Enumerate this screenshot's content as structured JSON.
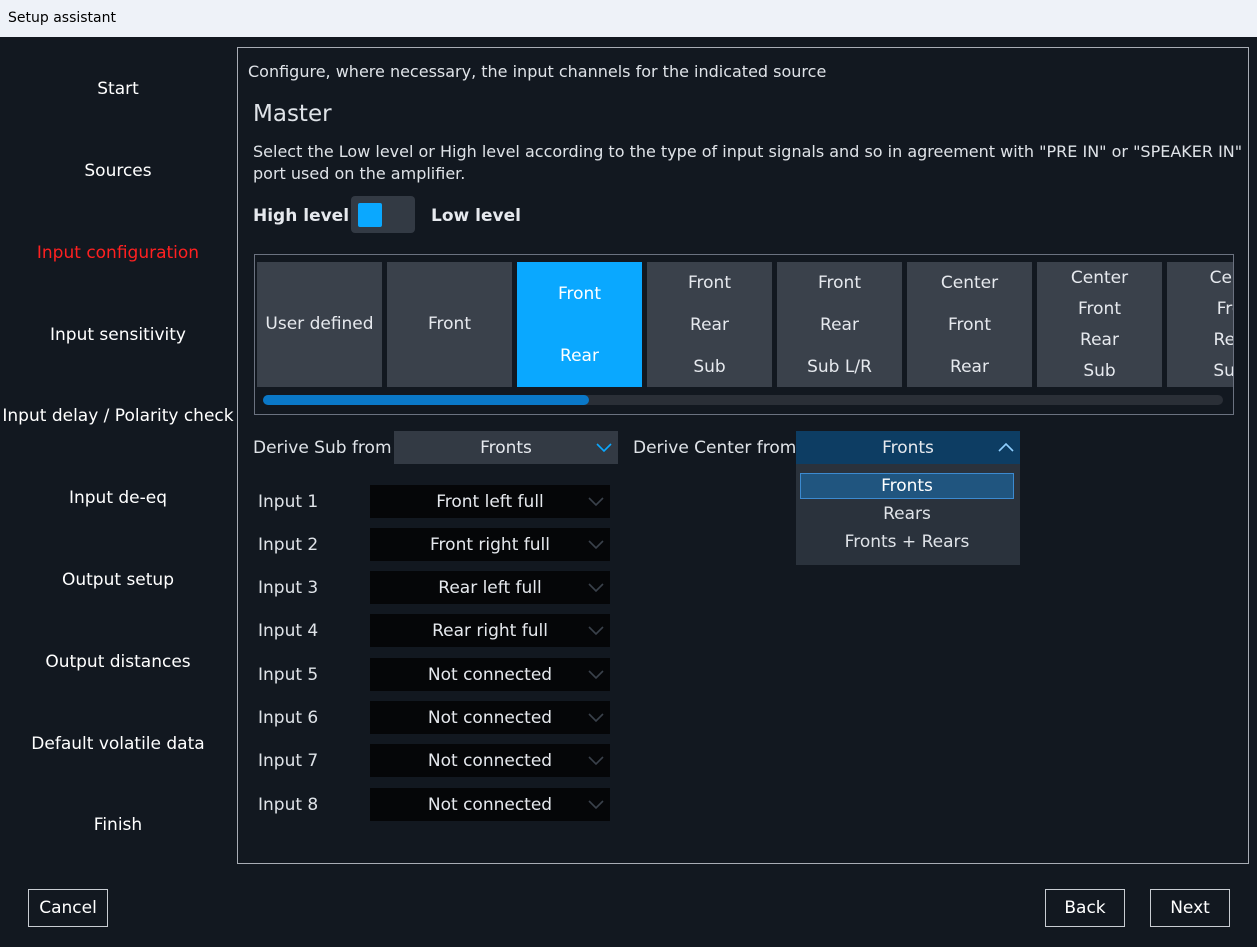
{
  "window": {
    "title": "Setup assistant"
  },
  "sidebar": {
    "items": [
      {
        "label": "Start"
      },
      {
        "label": "Sources"
      },
      {
        "label": "Input configuration",
        "active": true
      },
      {
        "label": "Input sensitivity"
      },
      {
        "label": "Input delay / Polarity check"
      },
      {
        "label": "Input de-eq"
      },
      {
        "label": "Output setup"
      },
      {
        "label": "Output distances"
      },
      {
        "label": "Default volatile data"
      },
      {
        "label": "Finish"
      }
    ],
    "active_color": "#ff2020"
  },
  "main": {
    "intro": "Configure, where necessary, the input channels for the indicated source",
    "section_title": "Master",
    "description": "Select the Low level or High level according to the type of input signals and so in agreement with \"PRE IN\" or \"SPEAKER IN\" port used on the amplifier.",
    "level_toggle": {
      "left_label": "High level",
      "right_label": "Low level",
      "state": "High level"
    },
    "presets": [
      {
        "lines": [
          "User defined"
        ]
      },
      {
        "lines": [
          "Front"
        ]
      },
      {
        "lines": [
          "Front",
          "Rear"
        ],
        "selected": true
      },
      {
        "lines": [
          "Front",
          "Rear",
          "Sub"
        ]
      },
      {
        "lines": [
          "Front",
          "Rear",
          "Sub L/R"
        ]
      },
      {
        "lines": [
          "Center",
          "Front",
          "Rear"
        ]
      },
      {
        "lines": [
          "Center",
          "Front",
          "Rear",
          "Sub"
        ]
      },
      {
        "lines": [
          "Cent",
          "Fro",
          "Rea",
          "Sub"
        ]
      }
    ],
    "preset_scroll_fraction": 0.34,
    "derive_sub": {
      "label": "Derive Sub from",
      "value": "Fronts"
    },
    "derive_center": {
      "label": "Derive Center from",
      "value": "Fronts",
      "options": [
        "Fronts",
        "Rears",
        "Fronts + Rears"
      ],
      "selected_index": 0
    },
    "inputs": [
      {
        "label": "Input 1",
        "value": "Front left full"
      },
      {
        "label": "Input 2",
        "value": "Front right full"
      },
      {
        "label": "Input 3",
        "value": "Rear left full"
      },
      {
        "label": "Input 4",
        "value": "Rear right full"
      },
      {
        "label": "Input 5",
        "value": "Not connected"
      },
      {
        "label": "Input 6",
        "value": "Not connected"
      },
      {
        "label": "Input 7",
        "value": "Not connected"
      },
      {
        "label": "Input 8",
        "value": "Not connected"
      }
    ]
  },
  "footer": {
    "cancel": "Cancel",
    "back": "Back",
    "next": "Next"
  },
  "colors": {
    "accent": "#0aa8ff",
    "background": "#121820",
    "tile": "#3a414b"
  }
}
